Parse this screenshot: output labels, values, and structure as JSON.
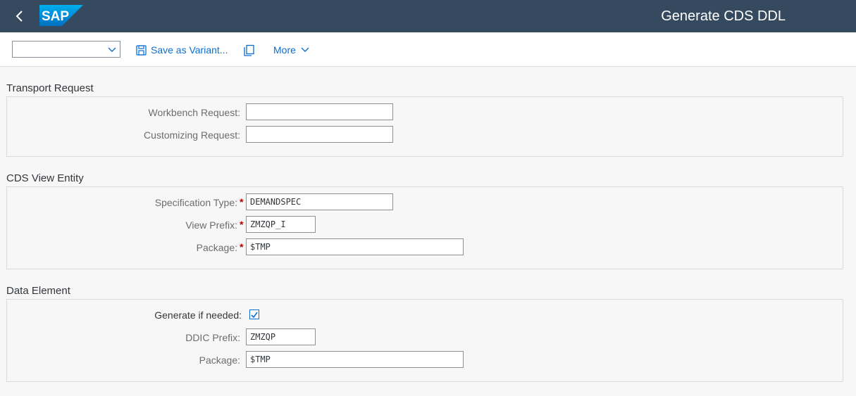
{
  "shell": {
    "logo_text": "SAP",
    "title": "Generate CDS DDL",
    "back_icon": "chevron-left-icon"
  },
  "toolbar": {
    "variant_value": "",
    "save_variant_label": "Save as Variant...",
    "save_icon": "save-icon",
    "copy_icon": "copy-icon",
    "more_label": "More"
  },
  "sections": {
    "transport": {
      "title": "Transport Request",
      "workbench_label": "Workbench Request:",
      "workbench_value": "",
      "customizing_label": "Customizing Request:",
      "customizing_value": ""
    },
    "cds": {
      "title": "CDS View Entity",
      "spec_type_label": "Specification Type:",
      "spec_type_value": "DEMANDSPEC",
      "view_prefix_label": "View Prefix:",
      "view_prefix_value": "ZMZQP_I",
      "package_label": "Package:",
      "package_value": "$TMP",
      "required_mark": "*"
    },
    "data_element": {
      "title": "Data Element",
      "generate_label": "Generate if needed:",
      "generate_checked": true,
      "ddic_prefix_label": "DDIC Prefix:",
      "ddic_prefix_value": "ZMZQP",
      "package_label": "Package:",
      "package_value": "$TMP"
    }
  },
  "colors": {
    "shell_bg": "#354a5f",
    "accent": "#0a6ed1",
    "required": "#bb0000"
  }
}
